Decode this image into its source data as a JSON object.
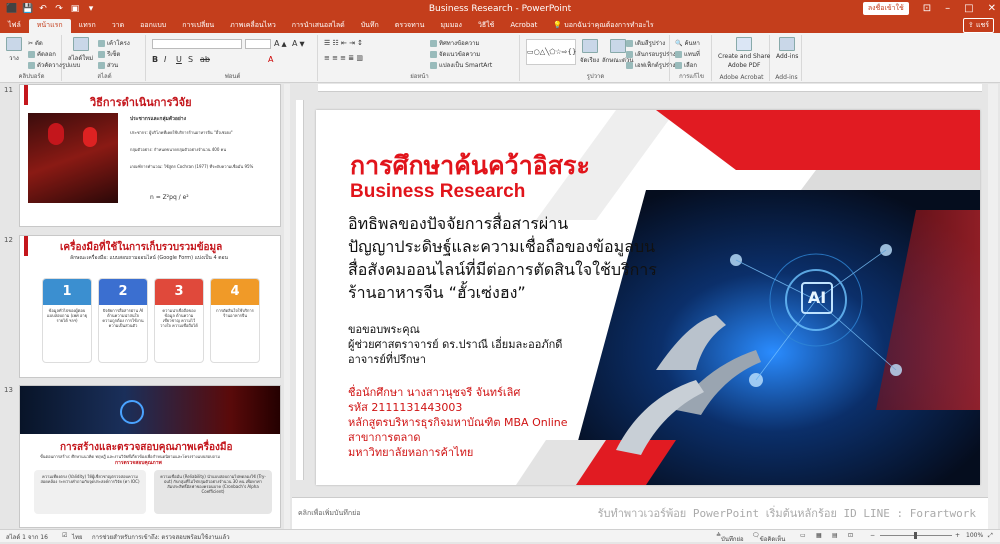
{
  "window": {
    "title": "Business Research  -  PowerPoint",
    "sign_in": "ลงชื่อเข้าใช้"
  },
  "tabs": [
    "ไฟล์",
    "หน้าแรก",
    "แทรก",
    "วาด",
    "ออกแบบ",
    "การเปลี่ยน",
    "ภาพเคลื่อนไหว",
    "การนำเสนอสไลด์",
    "บันทึก",
    "ตรวจทาน",
    "มุมมอง",
    "วิธีใช้",
    "Acrobat"
  ],
  "active_tab": "หน้าแรก",
  "tell_me": "บอกฉันว่าคุณต้องการทำอะไร",
  "share_label": "แชร์",
  "ribbon": {
    "clipboard": {
      "paste": "วาง",
      "cut": "ตัด",
      "copy": "คัดลอก",
      "format_painter": "ตัวคัดวางรูปแบบ",
      "label": "คลิปบอร์ด"
    },
    "slides": {
      "new_slide": "สไลด์ใหม่",
      "layout": "เค้าโครง",
      "reset": "รีเซ็ต",
      "section": "ส่วน",
      "label": "สไลด์"
    },
    "font_label": "ฟอนต์",
    "paragraph": {
      "text_direction": "ทิศทางข้อความ",
      "align_text": "จัดแนวข้อความ",
      "smartart": "แปลงเป็น SmartArt",
      "label": "ย่อหน้า"
    },
    "drawing": {
      "label": "รูปวาด",
      "arrange": "จัดเรียง",
      "quick_styles": "ลักษณะด่วน",
      "shape_fill": "เติมสีรูปร่าง",
      "shape_outline": "เส้นกรอบรูปร่าง",
      "shape_effects": "เอฟเฟ็กต์รูปร่าง"
    },
    "editing": {
      "find": "ค้นหา",
      "replace": "แทนที่",
      "select": "เลือก",
      "label": "การแก้ไข"
    },
    "acrobat": {
      "create_share": "Create and Share",
      "adobe_pdf": "Adobe PDF",
      "label": "Adobe Acrobat"
    },
    "addins": {
      "button": "Add-ins",
      "label": "Add-ins"
    }
  },
  "thumbnails": [
    {
      "number": "11",
      "title": "วิธีการดำเนินการวิจัย",
      "sub_heading": "ประชากรและกลุ่มตัวอย่าง",
      "lines": [
        "ประชากร: ผู้บริโภคที่เคยใช้บริการร้านอาหารจีน \"ฮั้วเซ่งฮง\"",
        "กลุ่มตัวอย่าง: กำหนดขนาดกลุ่มตัวอย่างจำนวน 400 คน",
        "เกณฑ์การคำนวณ: ใช้สูตร Cochran (1977) ที่ระดับความเชื่อมั่น 95%"
      ],
      "formula": "n  =  Z²pq / e²"
    },
    {
      "number": "12",
      "title": "เครื่องมือที่ใช้ในการเก็บรวบรวมข้อมูล",
      "subtitle": "ลักษณะเครื่องมือ: แบบสอบถามออนไลน์ (Google Form) แบ่งเป็น 4 ตอน",
      "cards": [
        {
          "num": "1",
          "text": "ข้อมูลทั่วไปของผู้ตอบแบบสอบถาม (เพศ อายุ รายได้ ฯลฯ)",
          "color": "#3b8fd0"
        },
        {
          "num": "2",
          "text": "ปัจจัยการสื่อสารผ่าน AI ด้านความน่าสนใจ ความถูกต้อง การใช้งาน ความเป็นส่วนตัว",
          "color": "#3b6fd0"
        },
        {
          "num": "3",
          "text": "ความน่าเชื่อถือของข้อมูล ด้านความเชี่ยวชาญ ความไว้วางใจ ความเชื่อถือได้",
          "color": "#e0493b"
        },
        {
          "num": "4",
          "text": "การตัดสินใจใช้บริการร้านอาหารจีน",
          "color": "#f09a28"
        }
      ]
    },
    {
      "number": "13",
      "title": "การสร้างและตรวจสอบคุณภาพเครื่องมือ",
      "subtitle": "ขั้นตอนการสร้าง: ศึกษาแนวคิด ทฤษฎี และงานวิจัยที่เกี่ยวข้องเพื่อกำหนดนิยามและโครงร่างแบบสอบถาม",
      "highlight": "การตรวจสอบคุณภาพ",
      "validity": "ความเที่ยงตรง (Validity) ให้ผู้เชี่ยวชาญตรวจสอบความสอดคล้อง ระหว่างคำถามกับจุดประสงค์การวิจัย (ค่า IOC)",
      "reliability": "ความเชื่อมั่น (Reliability) นำแบบสอบถามไปทดลองใช้ (Try-out) กับกลุ่มที่ไม่ใช่กลุ่มตัวอย่างจำนวน 30 คน เพื่อหาค่าสัมประสิทธิ์อัลฟาของครอนบาค (Cronbach's Alpha Coefficient)"
    }
  ],
  "slide": {
    "title_th": "การศึกษาค้นคว้าอิสระ",
    "title_en": "Business Research",
    "body": [
      "อิทธิพลของปัจจัยการสื่อสารผ่าน",
      "ปัญญาประดิษฐ์และความเชื่อถือของข้อมูลบน",
      "สื่อสังคมออนไลน์ที่มีต่อการตัดสินใจใช้บริการ",
      "ร้านอาหารจีน  “ฮั้วเซ่งฮง”"
    ],
    "advisor": [
      "ขอขอบพระคุณ",
      "ผู้ช่วยศาสตราจารย์ ดร.ปราณี  เอี่ยมละออภักดี",
      "อาจารย์ที่ปรึกษา"
    ],
    "student": [
      "ชื่อนักศึกษา  นางสาวนุชจรี  จันทร์เลิศ",
      "รหัส 2111131443003",
      "หลักสูตรบริหารธุรกิจมหาบัณฑิต  MBA Online",
      "สาขาการตลาด",
      "มหาวิทยาลัยหอการค้าไทย"
    ],
    "ai_label": "AI"
  },
  "notes": {
    "placeholder": "คลิกเพื่อเพิ่มบันทึกย่อ",
    "watermark": "รับทำพาวเวอร์พ้อย PowerPoint เริ่มต้นหลักร้อย ID LINE : Forartwork"
  },
  "status": {
    "slide_info": "สไลด์ 1 จาก 16",
    "language": "ไทย",
    "accessibility": "การช่วยสำหรับการเข้าถึง: ตรวจสอบพร้อมใช้งานแล้ว",
    "notes_btn": "บันทึกย่อ",
    "comments_btn": "ข้อคิดเห็น",
    "zoom": "100%"
  }
}
